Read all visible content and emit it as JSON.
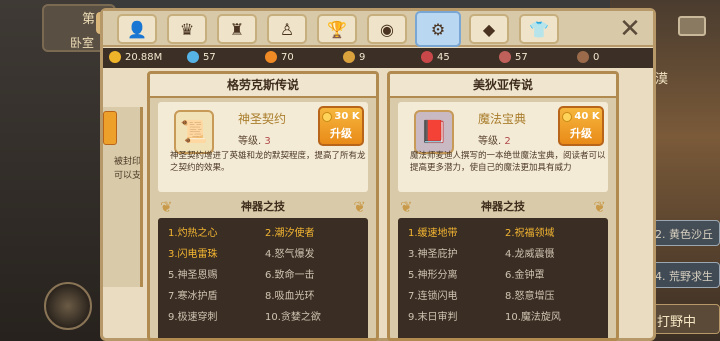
{
  "background": {
    "left_title": "第",
    "left_subtitle": "卧室",
    "right_label": "沙漠",
    "right_items": [
      "2. 黄色沙丘",
      "4. 荒野求生"
    ],
    "right_bottom": "打野中"
  },
  "tabs": [
    {
      "icon": "person-icon",
      "glyph": "👤"
    },
    {
      "icon": "crest-icon",
      "glyph": "♛"
    },
    {
      "icon": "castle-icon",
      "glyph": "♜"
    },
    {
      "icon": "figure-icon",
      "glyph": "♙"
    },
    {
      "icon": "trophy-icon",
      "glyph": "🏆"
    },
    {
      "icon": "orb-icon",
      "glyph": "◉"
    },
    {
      "icon": "gem-gear-icon",
      "glyph": "⚙"
    },
    {
      "icon": "crystal-icon",
      "glyph": "◆"
    },
    {
      "icon": "shirt-icon",
      "glyph": "👕"
    }
  ],
  "resources": [
    {
      "name": "gold",
      "value": "20.88M",
      "color": "#f0b42a"
    },
    {
      "name": "diamond",
      "value": "57",
      "color": "#56b3e6"
    },
    {
      "name": "orange-orb",
      "value": "70",
      "color": "#f08a24"
    },
    {
      "name": "wing-gem",
      "value": "9",
      "color": "#d9a23d"
    },
    {
      "name": "red-gem",
      "value": "45",
      "color": "#c8484a"
    },
    {
      "name": "pink-gem",
      "value": "57",
      "color": "#c0605a"
    },
    {
      "name": "ring",
      "value": "0",
      "color": "#9a6a4a"
    }
  ],
  "partial_card": {
    "text": "被封印\n可以支"
  },
  "cards": [
    {
      "title": "格劳克斯传说",
      "artifact_name": "神圣契约",
      "level_label": "等级.",
      "level": "3",
      "description": "神圣契约增进了英雄和龙的默契程度，提高了所有龙之契约的效果。",
      "upgrade_cost": "30 K",
      "upgrade_label": "升级",
      "skills_header": "神器之技",
      "skills": [
        {
          "text": "1.灼热之心",
          "on": true
        },
        {
          "text": "2.潮汐使者",
          "on": true
        },
        {
          "text": "3.闪电雷珠",
          "on": true
        },
        {
          "text": "4.怒气爆发",
          "on": false
        },
        {
          "text": "5.神圣恩赐",
          "on": false
        },
        {
          "text": "6.致命一击",
          "on": false
        },
        {
          "text": "7.寒冰护盾",
          "on": false
        },
        {
          "text": "8.吸血光环",
          "on": false
        },
        {
          "text": "9.极速穿刺",
          "on": false
        },
        {
          "text": "10.贪婪之欲",
          "on": false
        }
      ]
    },
    {
      "title": "美狄亚传说",
      "artifact_name": "魔法宝典",
      "level_label": "等级.",
      "level": "2",
      "description": "魔法师麦迪人撰写的一本绝世魔法宝典，阅读者可以提高更多潜力，使自己的魔法更加具有威力",
      "upgrade_cost": "40 K",
      "upgrade_label": "升级",
      "skills_header": "神器之技",
      "skills": [
        {
          "text": "1.缓速地带",
          "on": true
        },
        {
          "text": "2.祝福领域",
          "on": true
        },
        {
          "text": "3.神圣庇护",
          "on": false
        },
        {
          "text": "4.龙威震慑",
          "on": false
        },
        {
          "text": "5.神形分离",
          "on": false
        },
        {
          "text": "6.金钟罩",
          "on": false
        },
        {
          "text": "7.连锁闪电",
          "on": false
        },
        {
          "text": "8.怒意增压",
          "on": false
        },
        {
          "text": "9.末日审判",
          "on": false
        },
        {
          "text": "10.魔法旋风",
          "on": false
        }
      ]
    }
  ]
}
